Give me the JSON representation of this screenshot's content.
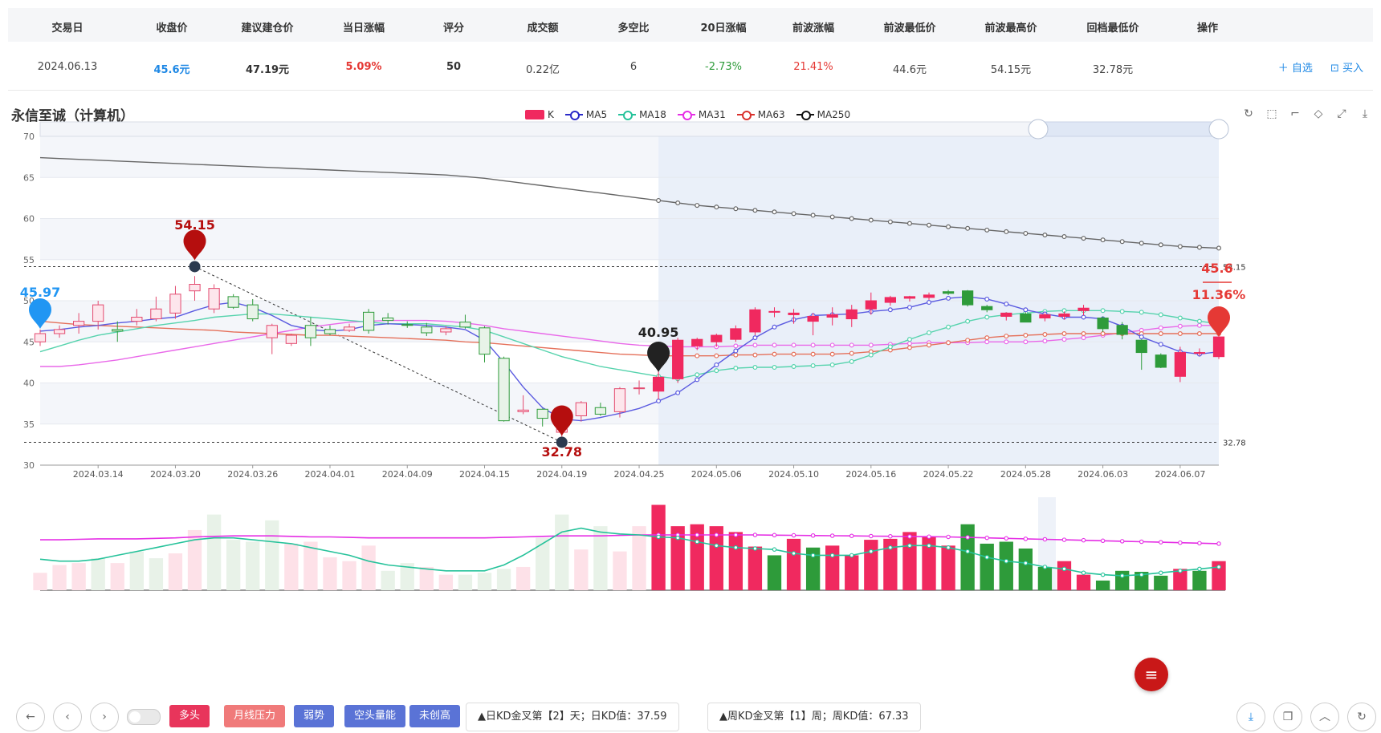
{
  "table": {
    "headers": [
      "交易日",
      "收盘价",
      "建议建仓价",
      "当日涨幅",
      "评分",
      "成交额",
      "多空比",
      "20日涨幅",
      "前波涨幅",
      "前波最低价",
      "前波最高价",
      "回档最低价",
      "操作"
    ],
    "row": {
      "date": "2024.06.13",
      "close": "45.6元",
      "suggest_price": "47.19元",
      "day_change": "5.09%",
      "score": "50",
      "turnover": "0.22亿",
      "ratio": "6",
      "change20": "-2.73%",
      "prev_wave_change": "21.41%",
      "prev_wave_low": "44.6元",
      "prev_wave_high": "54.15元",
      "pullback_low": "32.78元"
    },
    "ops": {
      "watch": "＋ 自选",
      "buy": "⊡ 买入"
    }
  },
  "stock_name": "永信至诚（计算机）",
  "legend": [
    {
      "label": "K",
      "color": "#f0295f"
    },
    {
      "label": "MA5",
      "color": "#2a2ac8"
    },
    {
      "label": "MA18",
      "color": "#25c29a"
    },
    {
      "label": "MA31",
      "color": "#e52ee5"
    },
    {
      "label": "MA63",
      "color": "#d9312d"
    },
    {
      "label": "MA250",
      "color": "#111111"
    }
  ],
  "toolbar_icons": [
    "refresh-icon",
    "zoom-select-icon",
    "zoom-reset-icon",
    "restore-icon",
    "fullscreen-icon",
    "download-icon"
  ],
  "chart_data": {
    "type": "candlestick",
    "ylim": [
      30,
      70
    ],
    "y_ticks": [
      30,
      35,
      40,
      45,
      50,
      55,
      60,
      65,
      70
    ],
    "x_tick_labels": [
      "2024.03.14",
      "2024.03.20",
      "2024.03.26",
      "2024.04.01",
      "2024.04.09",
      "2024.04.15",
      "2024.04.19",
      "2024.04.25",
      "2024.05.06",
      "2024.05.10",
      "2024.05.16",
      "2024.05.22",
      "2024.05.28",
      "2024.06.03",
      "2024.06.07"
    ],
    "ohlc": [
      [
        45,
        46.5,
        44.5,
        46
      ],
      [
        46,
        47,
        45.5,
        46.5
      ],
      [
        47,
        48.5,
        46,
        47.5
      ],
      [
        47.5,
        50,
        46.5,
        49.5
      ],
      [
        46.5,
        47.5,
        45,
        46.3
      ],
      [
        47.5,
        49,
        47,
        48
      ],
      [
        47.8,
        50.5,
        47.5,
        49
      ],
      [
        48.5,
        51.8,
        47.8,
        50.8
      ],
      [
        51.2,
        53,
        50,
        52
      ],
      [
        49,
        52,
        48.5,
        51.5
      ],
      [
        50.5,
        50.8,
        49,
        49.2
      ],
      [
        49.5,
        50.2,
        47.5,
        47.8
      ],
      [
        45.5,
        47.2,
        43.5,
        47
      ],
      [
        44.8,
        46,
        44.5,
        45.8
      ],
      [
        47,
        48,
        44.5,
        45.5
      ],
      [
        46.5,
        47,
        45.8,
        46
      ],
      [
        46.4,
        47.2,
        46.2,
        46.8
      ],
      [
        48.6,
        49,
        46,
        46.4
      ],
      [
        47.9,
        48.5,
        47.1,
        47.6
      ],
      [
        47.1,
        47.5,
        46.7,
        47
      ],
      [
        46.8,
        47.3,
        45.7,
        46.1
      ],
      [
        46.2,
        46.9,
        45.8,
        46.6
      ],
      [
        47.4,
        48.3,
        46.6,
        46.8
      ],
      [
        46.7,
        46.9,
        42.5,
        43.5
      ],
      [
        43,
        43.2,
        35.3,
        35.4
      ],
      [
        36.5,
        38.5,
        36.2,
        36.7
      ],
      [
        36.8,
        36.9,
        34.7,
        35.7
      ],
      [
        34,
        34.9,
        33.3,
        34.4
      ],
      [
        36,
        37.8,
        35.3,
        37.6
      ],
      [
        37,
        37.6,
        36,
        36.2
      ],
      [
        36.5,
        39.5,
        35.8,
        39.3
      ],
      [
        39.3,
        40.3,
        38.6,
        39.4
      ],
      [
        39,
        41.5,
        38,
        40.7
      ],
      [
        40.5,
        45.5,
        40,
        45.2
      ],
      [
        44.5,
        45.5,
        44,
        45.3
      ],
      [
        45,
        46,
        44.4,
        45.8
      ],
      [
        45.3,
        47,
        45,
        46.6
      ],
      [
        46.2,
        49.2,
        45.8,
        48.9
      ],
      [
        48.6,
        49.2,
        48,
        48.7
      ],
      [
        48.3,
        49,
        47.2,
        48.5
      ],
      [
        47.5,
        48.5,
        45.8,
        48.1
      ],
      [
        48,
        49.2,
        47,
        48.3
      ],
      [
        47.8,
        49.5,
        46.8,
        48.9
      ],
      [
        49,
        51,
        48.3,
        50
      ],
      [
        49.8,
        50.6,
        49.4,
        50.4
      ],
      [
        50.3,
        50.6,
        49.9,
        50.5
      ],
      [
        50.4,
        51,
        50.1,
        50.7
      ],
      [
        51.1,
        51.3,
        50.7,
        50.9
      ],
      [
        51.2,
        51.3,
        49.3,
        49.5
      ],
      [
        49.3,
        49.5,
        48.6,
        48.9
      ],
      [
        48.1,
        48.6,
        47.6,
        48.5
      ],
      [
        48.4,
        48.6,
        47.4,
        47.4
      ],
      [
        47.9,
        48.5,
        47.5,
        48.3
      ],
      [
        48.1,
        48.7,
        47.7,
        48.4
      ],
      [
        48.8,
        49.5,
        48.2,
        49.1
      ],
      [
        47.9,
        48.1,
        46.2,
        46.6
      ],
      [
        47,
        47.4,
        45.3,
        45.9
      ],
      [
        45.2,
        45.3,
        41.6,
        43.7
      ],
      [
        43.4,
        43.6,
        41.8,
        41.9
      ],
      [
        40.8,
        44.4,
        40.1,
        43.7
      ],
      [
        43.6,
        44.2,
        43.3,
        43.7
      ],
      [
        43.2,
        45.9,
        42.9,
        45.6
      ]
    ],
    "ma5": [
      46.3,
      46.5,
      46.8,
      47,
      47.3,
      47.5,
      47.8,
      48,
      48.8,
      49.5,
      49.8,
      49.2,
      48.2,
      47,
      46.5,
      46.3,
      46.5,
      47,
      47.2,
      47.1,
      47,
      46.8,
      46.5,
      45.2,
      42.5,
      39.5,
      37,
      35.6,
      35.4,
      35.8,
      36.3,
      36.9,
      37.8,
      38.8,
      40.4,
      42.2,
      43.9,
      45.5,
      46.8,
      47.7,
      48.2,
      48.3,
      48.4,
      48.7,
      48.9,
      49.2,
      49.8,
      50.3,
      50.5,
      50.2,
      49.6,
      48.9,
      48.4,
      48,
      48,
      47.8,
      46.9,
      45.6,
      44.7,
      43.8,
      43.5,
      43.8
    ],
    "ma18": [
      43.8,
      44.5,
      45.2,
      45.8,
      46.2,
      46.6,
      47,
      47.3,
      47.6,
      48,
      48.2,
      48.4,
      48.4,
      48.2,
      48,
      47.8,
      47.6,
      47.4,
      47.2,
      47.2,
      47.2,
      47,
      46.8,
      46.4,
      45.6,
      44.8,
      44,
      43.2,
      42.6,
      42,
      41.6,
      41.2,
      40.8,
      40.5,
      41,
      41.5,
      41.8,
      41.9,
      41.9,
      42,
      42.1,
      42.2,
      42.6,
      43.4,
      44.4,
      45.3,
      46.1,
      46.8,
      47.5,
      48,
      48.3,
      48.5,
      48.7,
      48.8,
      48.8,
      48.8,
      48.7,
      48.6,
      48.3,
      47.9,
      47.5,
      47.2
    ],
    "ma31": [
      42,
      42,
      42.2,
      42.5,
      42.8,
      43.2,
      43.6,
      44,
      44.4,
      44.8,
      45.2,
      45.6,
      46,
      46.4,
      46.8,
      47.1,
      47.4,
      47.5,
      47.6,
      47.6,
      47.6,
      47.5,
      47.3,
      47,
      46.6,
      46.3,
      46,
      45.7,
      45.4,
      45.1,
      44.8,
      44.6,
      44.5,
      44.4,
      44.4,
      44.4,
      44.5,
      44.6,
      44.6,
      44.6,
      44.6,
      44.6,
      44.6,
      44.6,
      44.7,
      44.8,
      44.9,
      44.9,
      44.9,
      45,
      45,
      45,
      45.1,
      45.3,
      45.5,
      45.8,
      46.1,
      46.4,
      46.7,
      46.9,
      47,
      47
    ],
    "ma63": [
      47.5,
      47.3,
      47.1,
      47,
      46.9,
      46.8,
      46.7,
      46.6,
      46.5,
      46.4,
      46.2,
      46.1,
      46,
      45.9,
      45.8,
      45.8,
      45.7,
      45.6,
      45.5,
      45.4,
      45.3,
      45.2,
      45,
      44.9,
      44.7,
      44.5,
      44.3,
      44.1,
      43.9,
      43.7,
      43.5,
      43.4,
      43.3,
      43.3,
      43.3,
      43.3,
      43.4,
      43.4,
      43.5,
      43.5,
      43.5,
      43.5,
      43.6,
      43.8,
      44,
      44.3,
      44.6,
      44.9,
      45.2,
      45.5,
      45.7,
      45.8,
      45.9,
      46,
      46,
      46,
      46,
      46,
      46,
      46,
      46,
      46
    ],
    "ma250": [
      67.4,
      67.3,
      67.2,
      67.1,
      67,
      66.9,
      66.8,
      66.7,
      66.6,
      66.5,
      66.4,
      66.3,
      66.2,
      66.1,
      66,
      65.9,
      65.8,
      65.7,
      65.6,
      65.5,
      65.4,
      65.3,
      65.1,
      64.9,
      64.6,
      64.3,
      64,
      63.7,
      63.4,
      63.1,
      62.8,
      62.5,
      62.2,
      61.9,
      61.6,
      61.4,
      61.2,
      61,
      60.8,
      60.6,
      60.4,
      60.2,
      60,
      59.8,
      59.6,
      59.4,
      59.2,
      59,
      58.8,
      58.6,
      58.4,
      58.2,
      58,
      57.8,
      57.6,
      57.4,
      57.2,
      57,
      56.8,
      56.6,
      56.5,
      56.4
    ],
    "volume_up": [
      true,
      true,
      true,
      false,
      true,
      false,
      false,
      true,
      true,
      false,
      false,
      false,
      false,
      true,
      true,
      true,
      true,
      true,
      false,
      false,
      true,
      true,
      false,
      false,
      false,
      true,
      false,
      false,
      true,
      false,
      true,
      true,
      true,
      true,
      true,
      true,
      true,
      true,
      false,
      true,
      false,
      true,
      true,
      true,
      true,
      true,
      true,
      true,
      false,
      false,
      false,
      false,
      false,
      true,
      true,
      false,
      false,
      false,
      false,
      true,
      false,
      true
    ],
    "volume": [
      18,
      26,
      28,
      33,
      28,
      40,
      33,
      38,
      62,
      78,
      52,
      50,
      72,
      48,
      50,
      34,
      30,
      46,
      20,
      28,
      24,
      16,
      16,
      18,
      22,
      24,
      54,
      78,
      42,
      66,
      40,
      66,
      88,
      66,
      68,
      66,
      60,
      45,
      36,
      53,
      44,
      46,
      36,
      52,
      53,
      60,
      55,
      46,
      68,
      48,
      50,
      43,
      24,
      30,
      16,
      10,
      20,
      19,
      15,
      22,
      20,
      30
    ],
    "volume_ma_pink": [
      52,
      52,
      52.5,
      53,
      53,
      53,
      53.5,
      54,
      55,
      55.5,
      56,
      56,
      56,
      55.5,
      55,
      55,
      54.5,
      54,
      54,
      54,
      54,
      54,
      54,
      54,
      54.5,
      55,
      55.5,
      56,
      56,
      56,
      56.5,
      57,
      57,
      57,
      57,
      57,
      57,
      57,
      56.8,
      56.6,
      56.4,
      56.2,
      56,
      55.8,
      55.6,
      55.4,
      55.2,
      55,
      54.5,
      54,
      53.5,
      53,
      52.5,
      52,
      51.5,
      51,
      50.5,
      50,
      49.5,
      49,
      48.5,
      48
    ],
    "volume_ma_green": [
      32,
      30,
      30,
      32,
      36,
      40,
      44,
      48,
      52,
      54,
      54,
      52,
      50,
      48,
      44,
      40,
      36,
      30,
      26,
      24,
      22,
      20,
      20,
      20,
      26,
      36,
      48,
      60,
      64,
      60,
      58,
      57,
      55,
      54,
      50,
      46,
      44,
      43,
      42,
      38,
      36,
      36,
      36,
      40,
      44,
      46,
      46,
      44,
      40,
      34,
      30,
      28,
      24,
      22,
      18,
      16,
      15,
      16,
      18,
      20,
      22,
      24
    ],
    "markers": {
      "start_label": "45.97",
      "high_label": "54.15",
      "low_label": "32.78",
      "mid_label": "40.95",
      "last_price_label": "45.6",
      "last_change_label": "11.36%",
      "high_line_label": "54.15",
      "low_line_label": "32.78"
    }
  },
  "bottom": {
    "nav_icons": [
      "arrow-left-icon",
      "chevron-left-icon",
      "chevron-right-icon"
    ],
    "tags": [
      {
        "label": "多头",
        "color": "#e8355b"
      },
      {
        "label": "月线压力",
        "color": "#f07a7a"
      },
      {
        "label": "弱势",
        "color": "#5a73d6"
      },
      {
        "label": "空头量能",
        "color": "#5a73d6"
      },
      {
        "label": "未创高",
        "color": "#5a73d6"
      }
    ],
    "notes": [
      "▲日KD金叉第【2】天；日KD值：37.59",
      "▲周KD金叉第【1】周；周KD值：67.33"
    ],
    "right_icons": [
      "download-icon",
      "copy-icon",
      "arrow-up-icon",
      "refresh-icon"
    ]
  },
  "fab_icon": "menu-icon"
}
